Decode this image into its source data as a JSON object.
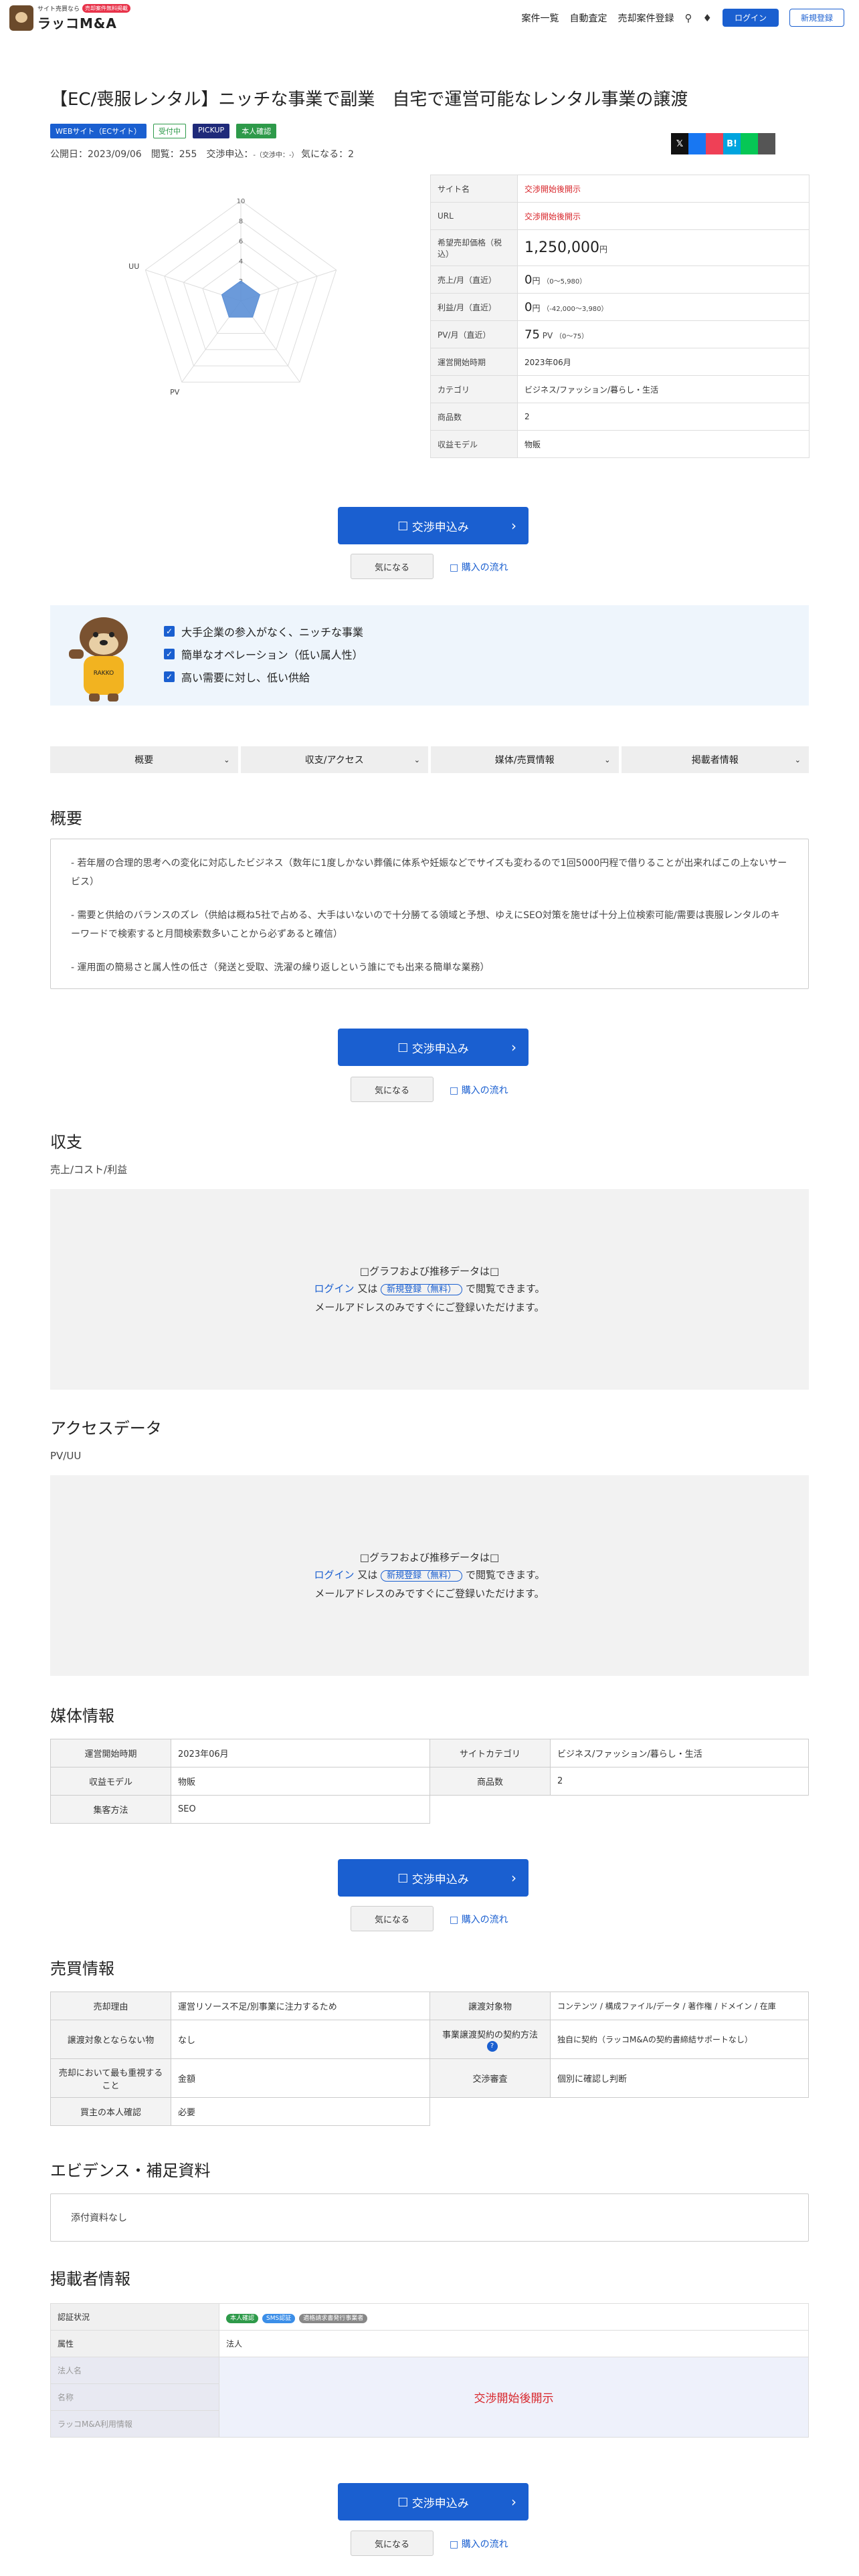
{
  "header": {
    "logo_sub": "サイト売買なら",
    "logo_badge": "売却案件無料掲載",
    "logo_main": "ラッコM&A",
    "nav": [
      "案件一覧",
      "自動査定",
      "売却案件登録"
    ],
    "login": "ログイン",
    "register": "新規登録"
  },
  "listing": {
    "title": "【EC/喪服レンタル】ニッチな事業で副業　自宅で運営可能なレンタル事業の譲渡",
    "tags": [
      {
        "label": "WEBサイト（ECサイト）",
        "color": "#1a5fd0",
        "filled": true
      },
      {
        "label": "受付中",
        "color": "#2e9a4a",
        "filled": false
      },
      {
        "label": "PICKUP",
        "color": "#1f2a7a",
        "filled": true
      },
      {
        "label": "本人確認",
        "color": "#2e9a4a",
        "filled": true
      }
    ],
    "meta_main": "公開日：2023/09/06　閲覧：255　交渉申込：",
    "meta_small": "-（交渉中：-）",
    "meta_fav": "気になる：2"
  },
  "share": [
    {
      "icon": "x-icon",
      "glyph": "𝕏",
      "color": "#111111"
    },
    {
      "icon": "facebook-icon",
      "glyph": "",
      "color": "#1877f2"
    },
    {
      "icon": "pocket-icon",
      "glyph": "",
      "color": "#ef4056"
    },
    {
      "icon": "hatena-icon",
      "glyph": "B!",
      "color": "#00a4de"
    },
    {
      "icon": "line-icon",
      "glyph": "",
      "color": "#06c755"
    },
    {
      "icon": "copy-icon",
      "glyph": "",
      "color": "#555555"
    }
  ],
  "chart_data": {
    "type": "radar",
    "axes": [
      "",
      "",
      "",
      "PV",
      "UU"
    ],
    "ticks": [
      "2",
      "4",
      "6",
      "8",
      "10"
    ],
    "range": [
      0,
      10
    ],
    "values": [
      2,
      2,
      2,
      2,
      2
    ],
    "fill": "#5b8fd6"
  },
  "info": {
    "site_name": {
      "k": "サイト名",
      "v": "交渉開始後開示"
    },
    "url": {
      "k": "URL",
      "v": "交渉開始後開示"
    },
    "price": {
      "k": "希望売却価格（税込）",
      "v": "1,250,000",
      "unit": "円"
    },
    "sales": {
      "k": "売上/月（直近）",
      "v": "0",
      "unit": "円",
      "range": "（0〜5,980）"
    },
    "profit": {
      "k": "利益/月（直近）",
      "v": "0",
      "unit": "円",
      "range_neg": "（-42,000",
      "range_pos": "〜3,980）"
    },
    "pv": {
      "k": "PV/月（直近）",
      "v": "75",
      "unit": "PV",
      "range": "（0〜75）"
    },
    "start": {
      "k": "運営開始時期",
      "v": "2023年06月"
    },
    "category": {
      "k": "カテゴリ",
      "v": "ビジネス/ファッション/暮らし・生活"
    },
    "products": {
      "k": "商品数",
      "v": "2"
    },
    "revenue": {
      "k": "収益モデル",
      "v": "物販"
    }
  },
  "cta": {
    "apply": "交渉申込み",
    "fav": "気になる",
    "flow": "購入の流れ"
  },
  "features": [
    "大手企業の参入がなく、ニッチな事業",
    "簡単なオペレーション（低い属人性）",
    "高い需要に対し、低い供給"
  ],
  "tabs": [
    "概要",
    "収支/アクセス",
    "媒体/売買情報",
    "掲載者情報"
  ],
  "overview": {
    "heading": "概要",
    "paras": [
      "- 若年層の合理的思考への変化に対応したビジネス（数年に1度しかない葬儀に体系や妊娠などでサイズも変わるので1回5000円程で借りることが出来ればこの上ないサービス）",
      "- 需要と供給のバランスのズレ（供給は概ね5社で占める、大手はいないので十分勝てる領域と予想、ゆえにSEO対策を施せば十分上位検索可能/需要は喪服レンタルのキーワードで検索すると月間検索数多いことから必ずあると確信）",
      "- 運用面の簡易さと属人性の低さ（発送と受取、洗濯の繰り返しという誰にでも出来る簡単な業務）"
    ]
  },
  "finance": {
    "heading": "収支",
    "sub": "売上/コスト/利益"
  },
  "access": {
    "heading": "アクセスデータ",
    "sub": "PV/UU"
  },
  "locked": {
    "l1": "グラフおよび推移データは",
    "login": "ログイン",
    "or": "又は",
    "reg": "新規登録（無料）",
    "tail": "で閲覧できます。",
    "l3": "メールアドレスのみですぐにご登録いただけます。"
  },
  "media": {
    "heading": "媒体情報",
    "rows": [
      {
        "k": "運営開始時期",
        "v": "2023年06月",
        "k2": "サイトカテゴリ",
        "v2": "ビジネス/ファッション/暮らし・生活"
      },
      {
        "k": "収益モデル",
        "v": "物販",
        "k2": "商品数",
        "v2": "2"
      },
      {
        "k": "集客方法",
        "v": "SEO"
      }
    ]
  },
  "trade": {
    "heading": "売買情報",
    "reason": {
      "k": "売却理由",
      "v": "運営リソース不足/別事業に注力するため"
    },
    "target": {
      "k": "譲渡対象物",
      "v": "コンテンツ / 構成ファイル/データ / 著作権 / ドメイン / 在庫"
    },
    "not_target": {
      "k": "譲渡対象とならない物",
      "v": "なし"
    },
    "contract": {
      "k": "事業譲渡契約の契約方法",
      "v": "独自に契約（ラッコM&Aの契約書締結サポートなし）"
    },
    "priority": {
      "k": "売却において最も重視すること",
      "v": "金額"
    },
    "review": {
      "k": "交渉審査",
      "v": "個別に確認し判断"
    },
    "buyer_id": {
      "k": "買主の本人確認",
      "v": "必要"
    }
  },
  "evidence": {
    "heading": "エビデンス・補足資料",
    "v": "添付資料なし"
  },
  "poster": {
    "heading": "掲載者情報",
    "auth": {
      "k": "認証状況",
      "b1": "本人確認",
      "b2": "SMS認証",
      "b3": "適格請求書発行事業者"
    },
    "type": {
      "k": "属性",
      "v": "法人"
    },
    "corp": {
      "k": "法人名"
    },
    "name": {
      "k": "名称",
      "v": "交渉開始後開示"
    },
    "usage": {
      "k": "ラッコM&A利用情報"
    }
  }
}
